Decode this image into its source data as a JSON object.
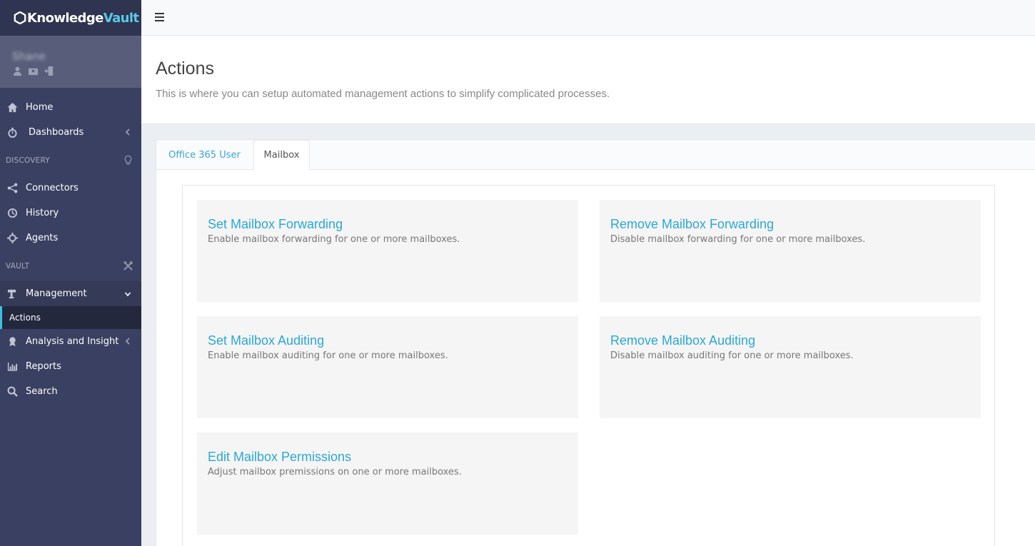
{
  "app": {
    "logo_part1": "Knowledge",
    "logo_part2": "Vault"
  },
  "user": {
    "name": "Shane"
  },
  "sidebar": {
    "items_top": [
      {
        "label": "Home",
        "icon": "home-icon"
      },
      {
        "label": "Dashboards",
        "icon": "stopwatch-icon"
      }
    ],
    "section_discovery": "DISCOVERY",
    "items_discovery": [
      {
        "label": "Connectors",
        "icon": "share-icon"
      },
      {
        "label": "History",
        "icon": "history-icon"
      },
      {
        "label": "Agents",
        "icon": "crosshair-icon"
      }
    ],
    "section_vault": "VAULT",
    "management": {
      "label": "Management",
      "icon": "gavel-icon"
    },
    "management_sub": "Actions",
    "items_vault": [
      {
        "label": "Analysis and Insight",
        "icon": "award-icon"
      },
      {
        "label": "Reports",
        "icon": "bar-chart-icon"
      },
      {
        "label": "Search",
        "icon": "search-icon"
      }
    ]
  },
  "page": {
    "title": "Actions",
    "subtitle": "This is where you can setup automated management actions to simplify complicated processes."
  },
  "tabs": [
    {
      "label": "Office 365 User",
      "active": false
    },
    {
      "label": "Mailbox",
      "active": true
    }
  ],
  "cards": [
    {
      "title": "Set Mailbox Forwarding",
      "desc": "Enable mailbox forwarding for one or more mailboxes."
    },
    {
      "title": "Remove Mailbox Forwarding",
      "desc": "Disable mailbox forwarding for one or more mailboxes."
    },
    {
      "title": "Set Mailbox Auditing",
      "desc": "Enable mailbox auditing for one or more mailboxes."
    },
    {
      "title": "Remove Mailbox Auditing",
      "desc": "Disable mailbox auditing for one or more mailboxes."
    },
    {
      "title": "Edit Mailbox Permissions",
      "desc": "Adjust mailbox premissions on one or more mailboxes."
    }
  ],
  "colors": {
    "sidebar": "#3a4061",
    "accent": "#2aa8d4"
  }
}
